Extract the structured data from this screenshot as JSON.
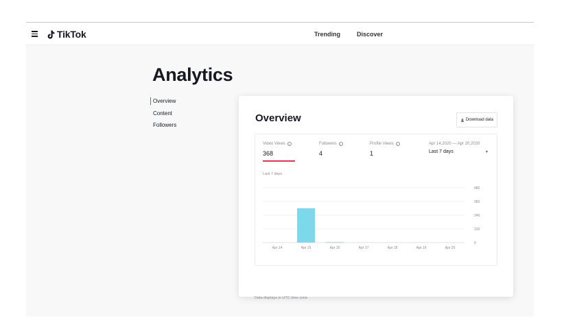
{
  "header": {
    "logo_text": "TikTok",
    "nav": [
      "Trending",
      "Discover"
    ]
  },
  "page": {
    "title": "Analytics"
  },
  "sidebar": {
    "items": [
      {
        "label": "Overview",
        "active": true
      },
      {
        "label": "Content",
        "active": false
      },
      {
        "label": "Followers",
        "active": false
      }
    ]
  },
  "overview": {
    "title": "Overview",
    "download_label": "Download data",
    "metrics": [
      {
        "label": "Video Views",
        "value": "368",
        "active": true
      },
      {
        "label": "Followers",
        "value": "4",
        "active": false
      },
      {
        "label": "Profile Views",
        "value": "1",
        "active": false
      }
    ],
    "date_range": "Apr 14,2020 — Apr 20,2020",
    "range_select": "Last 7 days",
    "chart_caption": "Last 7 days",
    "footnote": "Data displays in UTC time zone",
    "accent_color": "#fe2c55",
    "bar_color": "#7dd8ec"
  },
  "chart_data": {
    "type": "bar",
    "categories": [
      "Apr 14",
      "Apr 15",
      "Apr 16",
      "Apr 17",
      "Apr 18",
      "Apr 19",
      "Apr 20"
    ],
    "values": [
      0,
      300,
      4,
      0,
      0,
      0,
      0
    ],
    "yticks": [
      "480",
      "360",
      "240",
      "120",
      "0"
    ],
    "ylim": [
      0,
      480
    ],
    "grid": true
  }
}
